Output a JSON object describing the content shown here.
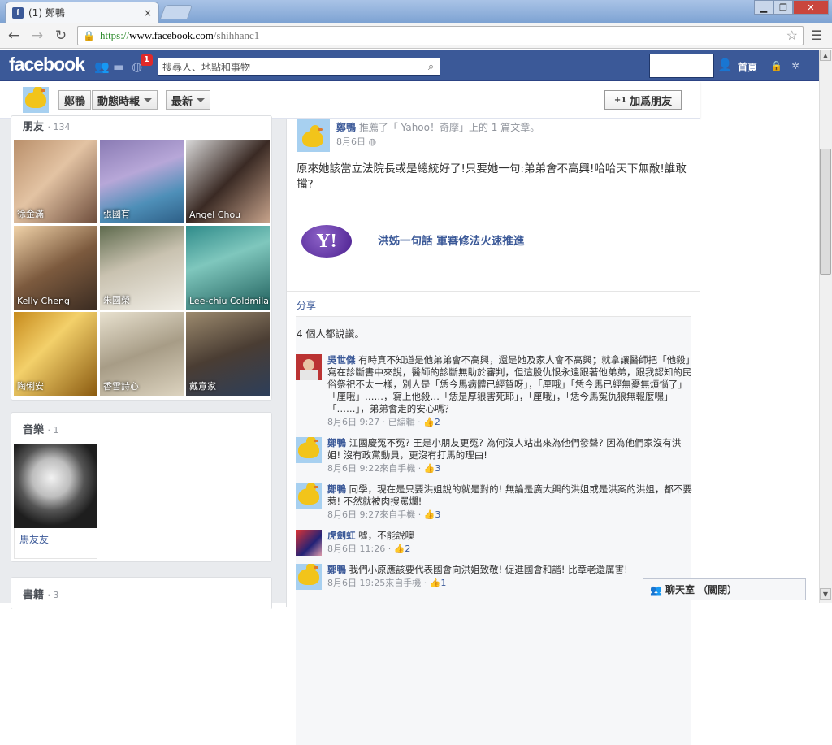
{
  "browser": {
    "tab_title": "(1) 鄭鴨",
    "tab_favicon": "f",
    "close_tab": "×",
    "url_scheme": "https://",
    "url_host": "www.facebook.com",
    "url_path": "/shihhanc1"
  },
  "fb": {
    "logo": "facebook",
    "notification_count": "1",
    "search_placeholder": "搜尋人、地點和事物",
    "home_label": "首頁"
  },
  "profile_bar": {
    "name": "鄭鴨",
    "timeline_label": "動態時報",
    "recent_label": "最新",
    "add_friend_label": "加爲朋友",
    "add_friend_prefix": "+1"
  },
  "friends": {
    "title": "朋友",
    "count": "· 134",
    "items": [
      {
        "name": "徐金滿"
      },
      {
        "name": "張國有"
      },
      {
        "name": "Angel Chou"
      },
      {
        "name": "Kelly Cheng"
      },
      {
        "name": "朱國榮"
      },
      {
        "name": "Lee-chiu Coldmila"
      },
      {
        "name": "陶俐安"
      },
      {
        "name": "香雪詩心"
      },
      {
        "name": "戴意家"
      }
    ]
  },
  "music": {
    "title": "音樂",
    "count": "· 1",
    "item": "馬友友"
  },
  "books": {
    "title": "書籍",
    "count": "· 3"
  },
  "post": {
    "author": "鄭鴨",
    "action": "推薦了「 Yahoo！奇摩」上的 1 篇文章。",
    "date": "8月6日",
    "text": "原來她該當立法院長或是總統好了!只要她一句:弟弟會不高興!哈哈天下無敵!誰敢擋?",
    "yahoo_logo": "Y!",
    "link_title": "洪姊一句話 軍審修法火速推進",
    "share_label": "分享",
    "likes_summary": "4 個人都說讚。"
  },
  "comments": [
    {
      "author": "吳世傑",
      "text": "有時真不知道是他弟弟會不高興，還是她及家人會不高興；就拿讓醫師把「他殺」寫在診斷書中來說，醫師的診斷無助於審判，但這股仇恨永遠跟著他弟弟，跟我認知的民俗祭祀不太一樣，別人是「恁今馬病體已經賀呀」，「厘哦」「恁今馬已經無憂無煩惱了」「厘哦」……，寫上他殺…「恁是厚狼害死耶」，「厘哦」，「恁今馬冤仇狼無報麼嘿」「……」，弟弟會走的安心嗎？",
      "time": "8月6日 9:27 · 已編輯 ·",
      "likes": "2"
    },
    {
      "author": "鄭鴨",
      "text": "江國慶冤不冤? 王是小朋友更冤? 為何沒人站出來為他們發聲? 因為他們家沒有洪姐! 沒有政黨動員，更沒有打馬的理由!",
      "time": "8月6日 9:22來自手機 ·",
      "likes": "3"
    },
    {
      "author": "鄭鴨",
      "text": "同學，現在是只要洪姐說的就是對的! 無論是廣大興的洪姐或是洪案的洪姐，都不要惹! 不然就被肉搜罵爛!",
      "time": "8月6日 9:27來自手機 ·",
      "likes": "3"
    },
    {
      "author": "虎劍虹",
      "text": "噓，不能說噢",
      "time": "8月6日 11:26 ·",
      "likes": "2"
    },
    {
      "author": "鄭鴨",
      "text": "我們小原應該要代表國會向洪姐致敬! 促進國會和諧! 比章老還厲害!",
      "time": "8月6日 19:25來自手機 ·",
      "likes": "1"
    }
  ],
  "chat": {
    "label": "聊天室 （關閉）"
  },
  "colors": {
    "fb_blue": "#3b5998",
    "link": "#3b5998",
    "notif_red": "#e02a2a"
  }
}
